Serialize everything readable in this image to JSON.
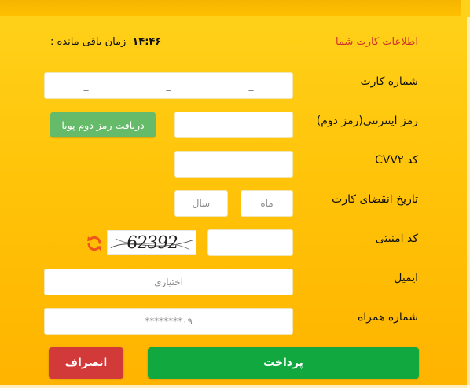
{
  "header": {
    "title": "اطلاعات کارت شما",
    "timer_label": "زمان باقی مانده :",
    "timer_value": "۱۴:۴۶"
  },
  "fields": {
    "card_number": {
      "label": "شماره کارت",
      "separators": [
        "_",
        "_",
        "_"
      ]
    },
    "internet_password": {
      "label": "رمز اینترنتی(رمز دوم)",
      "dynamic_button": "دریافت رمز دوم پویا"
    },
    "cvv2": {
      "label": "کد CVV۲"
    },
    "expiry": {
      "label": "تاریخ انقضای کارت",
      "month_placeholder": "ماه",
      "year_placeholder": "سال"
    },
    "captcha": {
      "label": "کد امنیتی",
      "image_text": "62392"
    },
    "email": {
      "label": "ایمیل",
      "placeholder": "اختیاری"
    },
    "mobile": {
      "label": "شماره همراه",
      "placeholder": "۰۹********"
    }
  },
  "buttons": {
    "pay": "پرداخت",
    "cancel": "انصراف"
  },
  "icons": {
    "refresh": "refresh-icon"
  },
  "colors": {
    "background": "#ffc107",
    "title_red": "#d32f2f",
    "pay_green": "#11a83f",
    "cancel_red": "#d23a3a",
    "dynamic_green": "#66bb6a",
    "refresh_orange": "#f0531c"
  }
}
